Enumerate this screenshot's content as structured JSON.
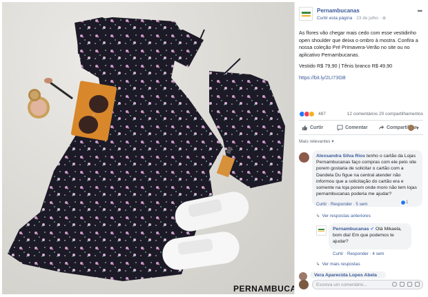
{
  "post": {
    "page_name": "Pernambucanas",
    "meta_link": "Curtir esta página",
    "meta_date": " · 23 de julho · ",
    "text_1": "As flores vão chegar mais cedo com esse vestidinho open shoulder que deixa o ombro à mostra. Confira a nossa coleção Pré Primavera-Verão no site ou no aplicativo Pernambucanas.",
    "text_2": "Vestido R$ 79,90 | Tênis branco R$ 49,90",
    "link": "https://bit.ly/2LI73GB"
  },
  "reactions": {
    "count": "487",
    "right": "12 comentários  20 compartilhamentos"
  },
  "actions": {
    "like": "Curtir",
    "comment": "Comentar",
    "share": "Compartilhar"
  },
  "relevant_label": "Mais relevantes ▾",
  "comments": [
    {
      "name": "Alexsandra Silva Rios",
      "text": "tenho o cartão da Lojas Pernambucanas faço compras com ele pelo site porem gostaria de solicitar o cartão com a Dandela Du figue na central atender não informou que a solicitação do cartão era e somente na loja porem onde moro não tem lojas pernambucanas poderia me ajudar?",
      "actions": "Curtir · Responder · 5 sem",
      "reaction_count": "1"
    }
  ],
  "more_replies_1": "Ver respostas anteriores",
  "reply": {
    "name": "Pernambucanas",
    "text": "Olá Mikaela, bom dia! Em que podemos te ajudar?",
    "actions": "Curtir · Responder · 4 sem"
  },
  "more_replies_2": "Ver mais respostas",
  "comment_2_name": "Vera Aparecida Lopes Abela",
  "input": {
    "placeholder": "Escreva um comentário..."
  },
  "photo": {
    "brand": "PERNAMBUCANAS"
  },
  "colors": {
    "link": "#385898",
    "like": "#2078f4",
    "love": "#f33e58",
    "wow": "#f7b125"
  }
}
